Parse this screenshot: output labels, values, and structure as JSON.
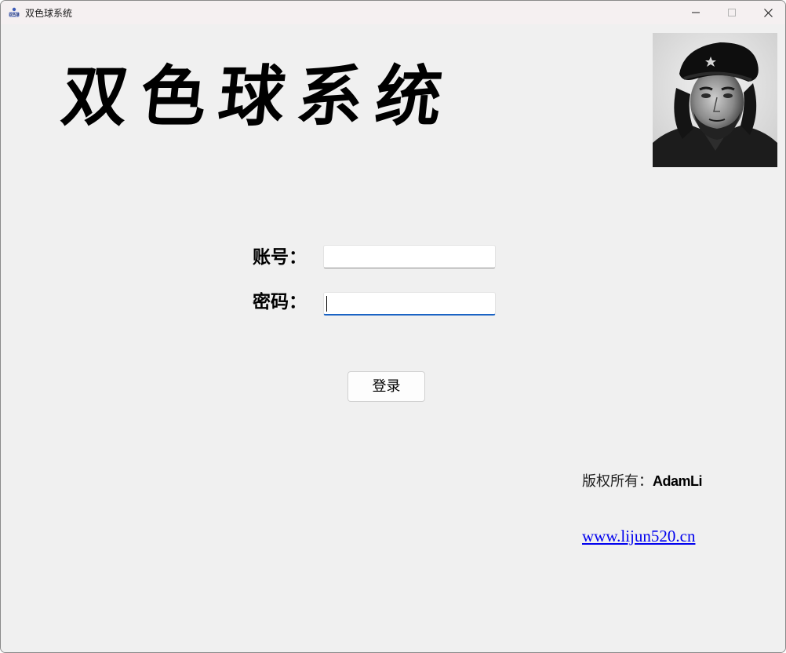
{
  "window": {
    "title": "双色球系统",
    "app_icon_text": "双色球",
    "controls": {
      "minimize_icon": "minimize-icon",
      "maximize_icon": "maximize-icon",
      "close_icon": "close-icon"
    }
  },
  "header": {
    "title": "双色球系统",
    "portrait_icon": "portrait-photo"
  },
  "form": {
    "account_label": "账号：",
    "account_value": "",
    "password_label": "密码：",
    "password_value": "",
    "login_button": "登录"
  },
  "footer": {
    "copyright_label": "版权所有：",
    "copyright_name": "AdamLi",
    "website": "www.lijun520.cn"
  },
  "colors": {
    "background": "#f0f0f0",
    "titlebar": "#f5f0f1",
    "focus_accent": "#1a63c4",
    "link": "#0000ee"
  }
}
